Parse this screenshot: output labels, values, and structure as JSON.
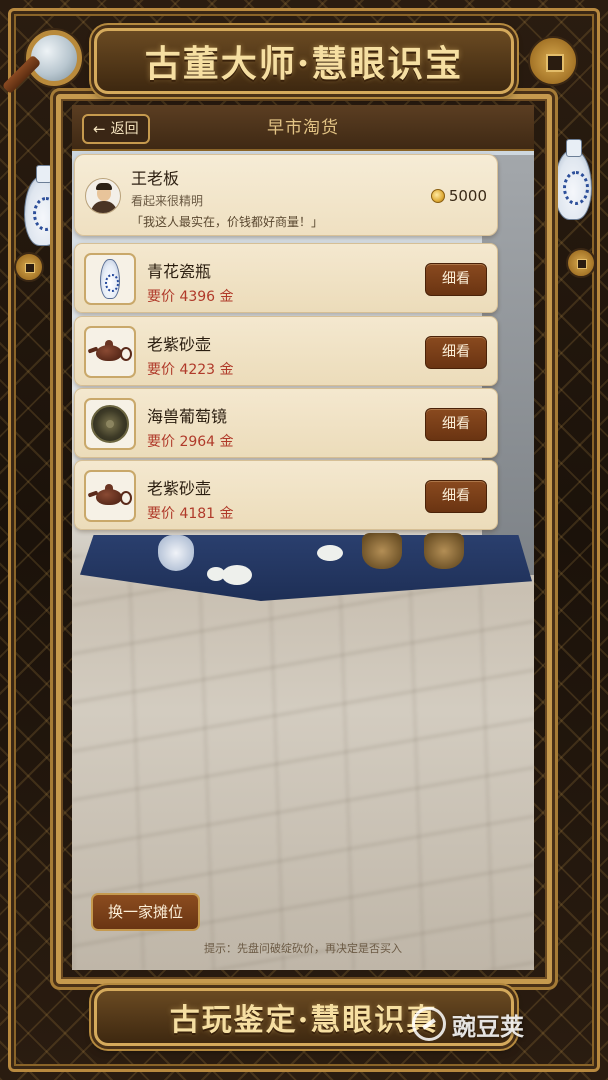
{
  "game": {
    "title": "古董大师·慧眼识宝",
    "bottom_banner": "古玩鉴定·慧眼识真"
  },
  "header": {
    "back_label": "返回",
    "back_icon": "arrow-left",
    "title": "早市淘货"
  },
  "merchant": {
    "name": "王老板",
    "description": "看起来很精明",
    "quote": "「我这人最实在，价钱都好商量！」",
    "gold": "5000",
    "gold_icon": "gold-coin"
  },
  "items": [
    {
      "name": "青花瓷瓶",
      "price_label": "要价",
      "price": "4396",
      "unit": "金",
      "icon": "blue-white-vase",
      "action": "细看"
    },
    {
      "name": "老紫砂壶",
      "price_label": "要价",
      "price": "4223",
      "unit": "金",
      "icon": "clay-teapot",
      "action": "细看"
    },
    {
      "name": "海兽葡萄镜",
      "price_label": "要价",
      "price": "2964",
      "unit": "金",
      "icon": "bronze-mirror",
      "action": "细看"
    },
    {
      "name": "老紫砂壶",
      "price_label": "要价",
      "price": "4181",
      "unit": "金",
      "icon": "clay-teapot",
      "action": "细看"
    }
  ],
  "footer": {
    "switch_label": "换一家摊位",
    "hint": "提示：先盘问破绽砍价，再决定是否买入"
  },
  "watermark": "豌豆荚",
  "colors": {
    "frame_gold": "#c69a4e",
    "frame_dark": "#2a1c10",
    "card_bg": "#f4e8cf",
    "button_brown": "#7a3f18",
    "price_red": "#b03a2a",
    "title_gold": "#f6dfa2"
  }
}
